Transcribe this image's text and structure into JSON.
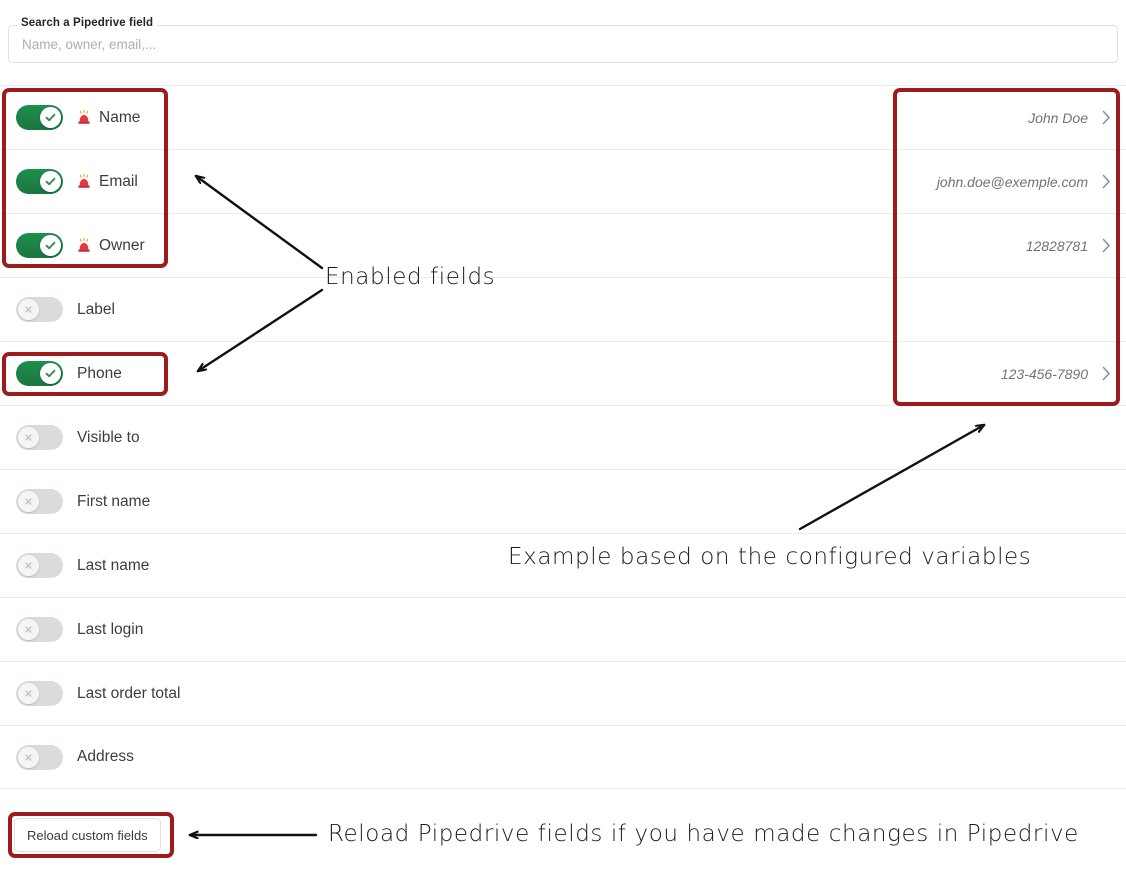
{
  "search": {
    "label": "Search a Pipedrive field",
    "placeholder": "Name, owner, email,...",
    "value": ""
  },
  "fields": [
    {
      "label": "Name",
      "enabled": true,
      "required": true,
      "value": "John Doe",
      "has_chevron": true
    },
    {
      "label": "Email",
      "enabled": true,
      "required": true,
      "value": "john.doe@exemple.com",
      "has_chevron": true
    },
    {
      "label": "Owner",
      "enabled": true,
      "required": true,
      "value": "12828781",
      "has_chevron": true
    },
    {
      "label": "Label",
      "enabled": false,
      "required": false,
      "value": "",
      "has_chevron": false
    },
    {
      "label": "Phone",
      "enabled": true,
      "required": false,
      "value": "123-456-7890",
      "has_chevron": true
    },
    {
      "label": "Visible to",
      "enabled": false,
      "required": false,
      "value": "",
      "has_chevron": false
    },
    {
      "label": "First name",
      "enabled": false,
      "required": false,
      "value": "",
      "has_chevron": false
    },
    {
      "label": "Last name",
      "enabled": false,
      "required": false,
      "value": "",
      "has_chevron": false
    },
    {
      "label": "Last login",
      "enabled": false,
      "required": false,
      "value": "",
      "has_chevron": false
    },
    {
      "label": "Last order total",
      "enabled": false,
      "required": false,
      "value": "",
      "has_chevron": false
    },
    {
      "label": "Address",
      "enabled": false,
      "required": false,
      "value": "",
      "has_chevron": false
    }
  ],
  "buttons": {
    "reload_custom_fields": "Reload custom fields"
  },
  "annotations": {
    "enabled_fields": "Enabled fields",
    "example_variables": "Example based on the configured variables",
    "reload_hint": "Reload Pipedrive fields if you have made changes in Pipedrive"
  },
  "icons": {
    "required_marker": "siren-icon",
    "toggle_on": "check-icon",
    "toggle_off": "close-icon",
    "row_expand": "chevron-right-icon"
  },
  "colors": {
    "toggle_on": "#1f8f50",
    "toggle_off": "#d9dbdd",
    "annotation_red": "#9e1b1b",
    "required_red": "#e23a3a",
    "label_text": "#3a3d42",
    "value_text": "#6f7378",
    "row_divider": "#ececee"
  }
}
